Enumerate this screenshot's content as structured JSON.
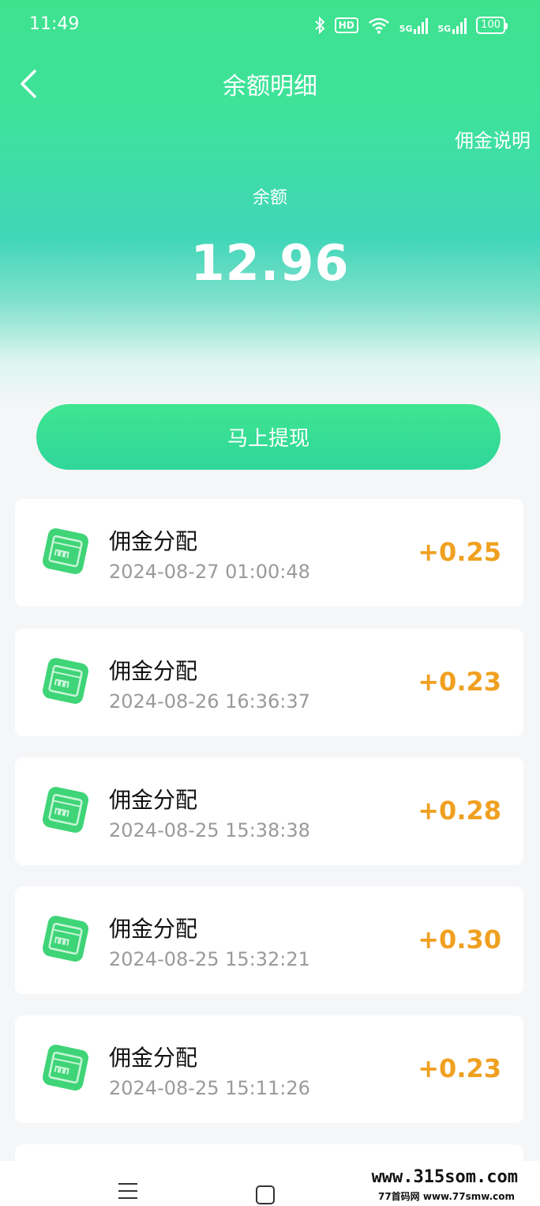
{
  "status_bar": {
    "time": "11:49",
    "hd_label": "HD",
    "net_label_1": "5G",
    "net_label_2": "5G",
    "battery": "100"
  },
  "header": {
    "title": "余额明细",
    "help_link": "佣金说明"
  },
  "balance": {
    "label": "余额",
    "value": "12.96"
  },
  "actions": {
    "withdraw_label": "马上提现"
  },
  "records": [
    {
      "title": "佣金分配",
      "time": "2024-08-27 01:00:48",
      "amount": "+0.25"
    },
    {
      "title": "佣金分配",
      "time": "2024-08-26 16:36:37",
      "amount": "+0.23"
    },
    {
      "title": "佣金分配",
      "time": "2024-08-25 15:38:38",
      "amount": "+0.28"
    },
    {
      "title": "佣金分配",
      "time": "2024-08-25 15:32:21",
      "amount": "+0.30"
    },
    {
      "title": "佣金分配",
      "time": "2024-08-25 15:11:26",
      "amount": "+0.23"
    }
  ],
  "watermark": {
    "line1": "www.315som.com",
    "line2": "77首码网 www.77smw.com"
  },
  "colors": {
    "primary_green": "#3ee28e",
    "amount_orange": "#f0a020"
  }
}
